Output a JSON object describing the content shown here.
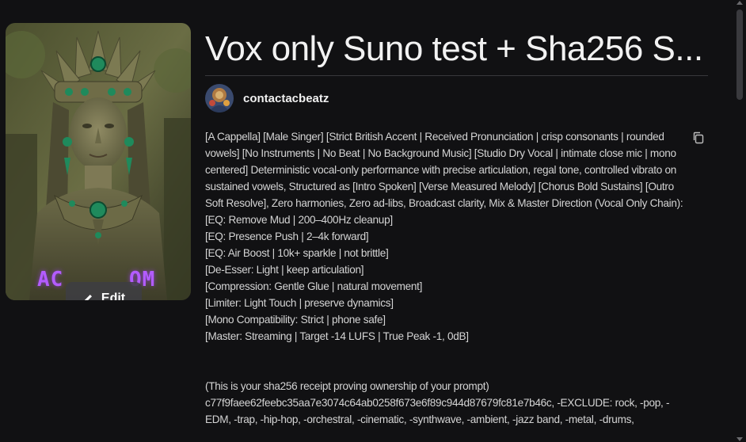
{
  "song": {
    "title": "Vox only Suno test + Sha256 S...",
    "cover_overlay_left": "AC",
    "cover_overlay_right": "OM",
    "edit_label": "Edit"
  },
  "author": {
    "name": "contactacbeatz"
  },
  "description": {
    "lines": [
      "[A Cappella] [Male Singer] [Strict British Accent | Received Pronunciation | crisp consonants | rounded vowels] [No Instruments | No Beat | No Background Music] [Studio Dry Vocal | intimate close mic | mono centered] Deterministic vocal-only performance with precise articulation, regal tone, controlled vibrato on sustained vowels, Structured as [Intro Spoken] [Verse Measured Melody] [Chorus Bold Sustains] [Outro Soft Resolve], Zero harmonies, Zero ad-libs, Broadcast clarity, Mix & Master Direction (Vocal Only Chain):",
      "[EQ: Remove Mud | 200–400Hz cleanup]",
      "[EQ: Presence Push | 2–4k forward]",
      "[EQ: Air Boost | 10k+ sparkle | not brittle]",
      "[De-Esser: Light | keep articulation]",
      "[Compression: Gentle Glue | natural movement]",
      "[Limiter: Light Touch | preserve dynamics]",
      "[Mono Compatibility: Strict | phone safe]",
      "[Master: Streaming | Target -14 LUFS | True Peak -1, 0dB]",
      "(This is your sha256 receipt proving ownership of your prompt)",
      "c77f9faee62feebc35aa7e3074c64ab0258f673e6f89c944d87679fc81e7b46c, -EXCLUDE: rock, -pop, -EDM, -trap, -hip-hop, -orchestral, -cinematic, -synthwave, -ambient, -jazz band, -metal, -drums,"
    ]
  },
  "icons": {
    "edit": "pencil-icon",
    "copy": "copy-icon"
  }
}
